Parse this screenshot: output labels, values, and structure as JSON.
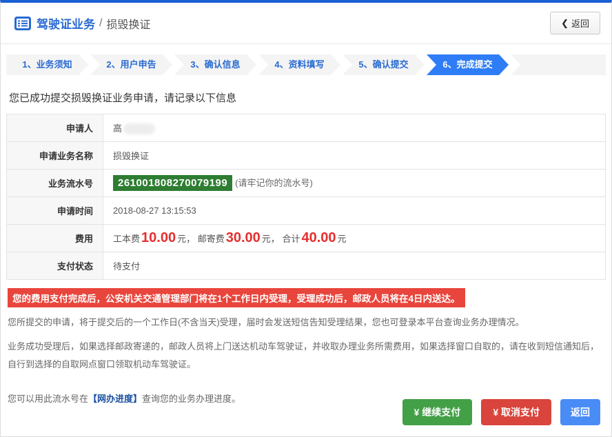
{
  "header": {
    "breadcrumb_main": "驾驶证业务",
    "breadcrumb_sep": "/",
    "breadcrumb_sub": "损毁换证",
    "back_chevron": "❮",
    "back_label": "返回"
  },
  "steps": [
    "1、业务须知",
    "2、用户申告",
    "3、确认信息",
    "4、资料填写",
    "5、确认提交",
    "6、完成提交"
  ],
  "active_step_index": 5,
  "success_message": "您已成功提交损毁换证业务申请，请记录以下信息",
  "table": {
    "applicant_label": "申请人",
    "applicant_value": "高",
    "service_label": "申请业务名称",
    "service_value": "损毁换证",
    "serial_label": "业务流水号",
    "serial_value": "261001808270079199",
    "serial_note": "(请牢记你的流水号)",
    "time_label": "申请时间",
    "time_value": "2018-08-27 13:15:53",
    "fee_label": "费用",
    "fee_item1_name": "工本费",
    "fee_item1_amount": "10.00",
    "fee_item1_unit": "元，",
    "fee_item2_name": "邮寄费",
    "fee_item2_amount": "30.00",
    "fee_item2_unit": "元，",
    "fee_total_name": "合计",
    "fee_total_amount": "40.00",
    "fee_total_unit": "元",
    "status_label": "支付状态",
    "status_value": "待支付"
  },
  "notices": {
    "banner": "您的费用支付完成后，公安机关交通管理部门将在1个工作日内受理，受理成功后，邮政人员将在4日内送达。",
    "p1": "您所提交的申请，将于提交后的一个工作日(不含当天)受理，届时会发送短信告知受理结果，您也可登录本平台查询业务办理情况。",
    "p2": "业务成功受理后，如果选择邮政寄递的，邮政人员将上门送达机动车驾驶证，并收取办理业务所需费用，如果选择窗口自取的，请在收到短信通知后，自行到选择的自取网点窗口领取机动车驾驶证。",
    "p3_prefix": "您可以用此流水号在",
    "p3_link": "【网办进度】",
    "p3_suffix": "查询您的业务办理进度。"
  },
  "footer": {
    "continue_pay": "¥ 继续支付",
    "cancel_pay": "¥ 取消支付",
    "back": "返回"
  },
  "colors": {
    "top_bar_blue": "#1a5fd4",
    "accent_blue": "#2a6bd2",
    "step_active_blue": "#2f7df6",
    "serial_green": "#2e7d32",
    "banner_red": "#e8453c",
    "fee_red": "#e62e2e",
    "button_green": "#43a047",
    "button_red": "#d9443c",
    "button_blue": "#4a8cf5"
  }
}
